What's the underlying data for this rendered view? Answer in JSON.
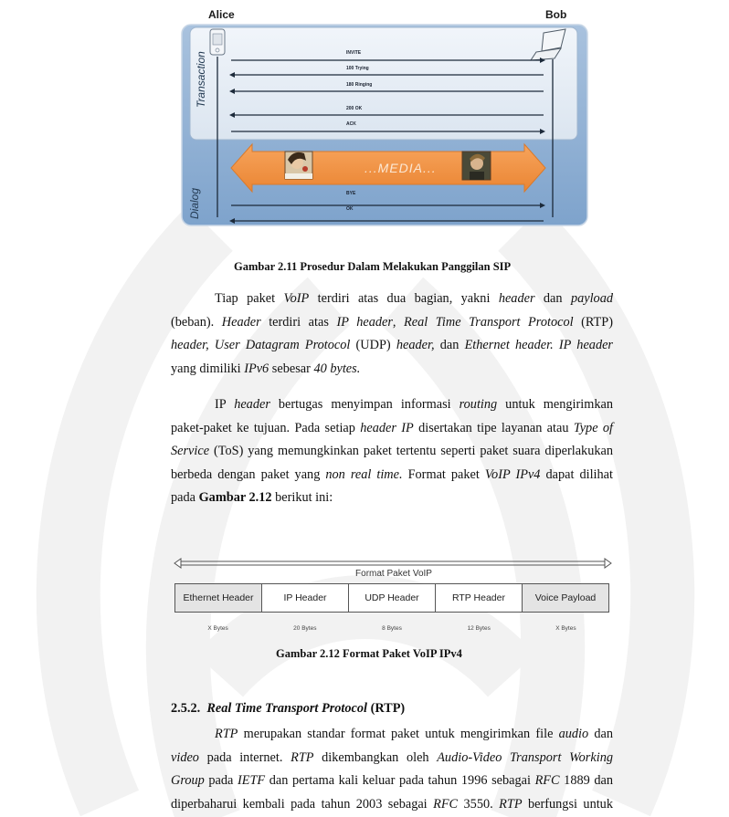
{
  "figure_sip": {
    "party_left": "Alice",
    "party_right": "Bob",
    "phase_transaction": "Transaction",
    "phase_dialog": "Dialog",
    "messages": [
      {
        "label": "INVITE",
        "direction": "right"
      },
      {
        "label": "100 Trying",
        "direction": "left"
      },
      {
        "label": "180 Ringing",
        "direction": "left"
      },
      {
        "label": "200 OK",
        "direction": "left"
      },
      {
        "label": "ACK",
        "direction": "right"
      }
    ],
    "media_label": "...MEDIA...",
    "dialog_messages": [
      {
        "label": "BYE",
        "direction": "right"
      },
      {
        "label": "OK",
        "direction": "left"
      }
    ],
    "icons": [
      "phone-icon",
      "laptop-icon",
      "female-avatar",
      "male-avatar"
    ],
    "colors": {
      "panel_outer": "#8fb0d4",
      "panel_inner": "#e4ecf5",
      "media": "#f0913f"
    },
    "caption": "Gambar 2.11 Prosedur Dalam Melakukan Panggilan SIP"
  },
  "paragraph1": {
    "lines": [
      [
        "Tiap paket ",
        {
          "i": "VoIP"
        },
        " terdiri atas dua bagian, yakni ",
        {
          "i": "header"
        },
        " dan ",
        {
          "i": "payload"
        }
      ],
      [
        "(beban). ",
        {
          "i": "Header"
        },
        " terdiri atas ",
        {
          "i": "IP header"
        },
        ", ",
        {
          "i": "Real Time Transport Protocol"
        },
        " (RTP)"
      ],
      [
        {
          "i": "header, User Datagram Protocol"
        },
        " (UDP) ",
        {
          "i": "header,"
        },
        " dan ",
        {
          "i": "Ethernet header. IP header"
        }
      ],
      [
        "yang dimiliki ",
        {
          "i": "IPv6"
        },
        " sebesar ",
        {
          "i": "40 bytes."
        }
      ]
    ]
  },
  "paragraph2": {
    "lines": [
      [
        "IP ",
        {
          "i": "header"
        },
        " bertugas menyimpan informasi ",
        {
          "i": "routing"
        },
        " untuk mengirimkan"
      ],
      [
        "paket-paket ke tujuan. Pada setiap ",
        {
          "i": "header IP"
        },
        " disertakan tipe layanan atau  ",
        {
          "i": "Type of"
        }
      ],
      [
        {
          "i": "Service"
        },
        " (ToS) yang memungkinkan paket tertentu seperti paket suara diperlakukan"
      ],
      [
        "berbeda dengan paket yang ",
        {
          "i": "non real time."
        },
        " Format paket ",
        {
          "i": "VoIP IPv4"
        },
        " dapat dilihat"
      ],
      [
        "pada ",
        {
          "b": "Gambar 2.12"
        },
        " berikut ini:"
      ]
    ]
  },
  "figure_packet": {
    "title": "Format Paket VoIP",
    "fields": [
      {
        "name": "Ethernet Header",
        "size": "X Bytes",
        "shaded": true
      },
      {
        "name": "IP Header",
        "size": "20 Bytes",
        "shaded": false
      },
      {
        "name": "UDP Header",
        "size": "8 Bytes",
        "shaded": false
      },
      {
        "name": "RTP Header",
        "size": "12 Bytes",
        "shaded": false
      },
      {
        "name": "Voice Payload",
        "size": "X Bytes",
        "shaded": true
      }
    ],
    "caption": "Gambar 2.12 Format Paket VoIP IPv4"
  },
  "section": {
    "number": "2.5.2.",
    "title_italic": "Real Time Transport Protocol",
    "title_suffix": " (RTP)"
  },
  "paragraph3": {
    "lines": [
      [
        {
          "i": "RTP"
        },
        " merupakan standar format paket untuk mengirimkan file ",
        {
          "i": "audio"
        },
        " dan"
      ],
      [
        {
          "i": "video"
        },
        " pada internet. ",
        {
          "i": "RTP"
        },
        " dikembangkan oleh ",
        {
          "i": "Audio-Video Transport Working"
        }
      ],
      [
        {
          "i": "Group"
        },
        " pada ",
        {
          "i": "IETF"
        },
        " dan pertama kali keluar pada tahun 1996 sebagai ",
        {
          "i": "RFC"
        },
        " 1889 dan"
      ],
      [
        "diperbaharui kembali pada tahun 2003 sebagai ",
        {
          "i": "RFC"
        },
        " 3550. ",
        {
          "i": "RTP"
        },
        " berfungsi untuk"
      ]
    ]
  }
}
